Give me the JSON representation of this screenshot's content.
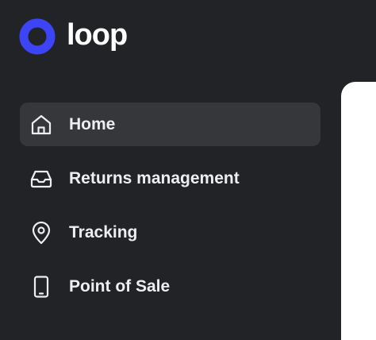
{
  "brand": {
    "name": "loop",
    "mark_icon": "ring-logo-icon",
    "mark_color": "#3d44f5"
  },
  "nav": {
    "items": [
      {
        "label": "Home",
        "icon": "home-icon",
        "active": true
      },
      {
        "label": "Returns management",
        "icon": "inbox-icon",
        "active": false
      },
      {
        "label": "Tracking",
        "icon": "location-pin-icon",
        "active": false
      },
      {
        "label": "Point of Sale",
        "icon": "mobile-device-icon",
        "active": false
      }
    ]
  },
  "colors": {
    "sidebar_bg": "#222326",
    "active_item_bg": "#36373b",
    "text": "#eeeef0",
    "content_bg": "#ffffff"
  }
}
